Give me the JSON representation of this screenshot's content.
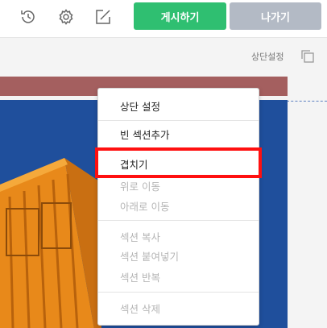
{
  "toolbar": {
    "history_icon": "history-icon",
    "settings_icon": "gear-icon",
    "edit_icon": "edit-icon",
    "post_label": "게시하기",
    "exit_label": "나가기",
    "colors": {
      "post": "#2fbf71",
      "exit": "#b3bac5"
    }
  },
  "editor": {
    "header_settings_label": "상단설정",
    "copy_icon": "copy-icon"
  },
  "context_menu": {
    "items": [
      {
        "label": "상단 설정",
        "enabled": true
      },
      {
        "label": "빈 섹션추가",
        "enabled": true
      },
      {
        "label": "겹치기",
        "enabled": true,
        "highlighted": true
      },
      {
        "label": "위로 이동",
        "enabled": false
      },
      {
        "label": "아래로 이동",
        "enabled": false
      },
      {
        "label": "섹션 복사",
        "enabled": false
      },
      {
        "label": "섹션 붙여넣기",
        "enabled": false
      },
      {
        "label": "섹션 반복",
        "enabled": false
      },
      {
        "label": "섹션 삭제",
        "enabled": false
      }
    ],
    "highlight_color": "#ff1010"
  }
}
